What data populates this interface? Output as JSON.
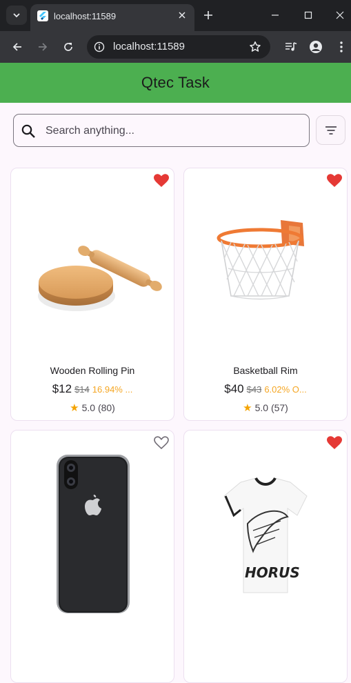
{
  "browser": {
    "tab_title": "localhost:11589",
    "url": "localhost:11589"
  },
  "app": {
    "title": "Qtec Task",
    "search_placeholder": "Search anything...",
    "accent_color": "#4caf50"
  },
  "products": [
    {
      "name": "Wooden Rolling Pin",
      "price": "$12",
      "old_price": "$14",
      "discount": "16.94% ...",
      "rating": "5.0 (80)",
      "favorite": true,
      "image": "rolling-pin"
    },
    {
      "name": "Basketball Rim",
      "price": "$40",
      "old_price": "$43",
      "discount": "6.02% O...",
      "rating": "5.0 (57)",
      "favorite": true,
      "image": "basketball-rim"
    },
    {
      "name": "",
      "price": "",
      "old_price": "",
      "discount": "",
      "rating": "",
      "favorite": false,
      "image": "iphone"
    },
    {
      "name": "",
      "price": "",
      "old_price": "",
      "discount": "",
      "rating": "",
      "favorite": true,
      "image": "tshirt"
    }
  ]
}
